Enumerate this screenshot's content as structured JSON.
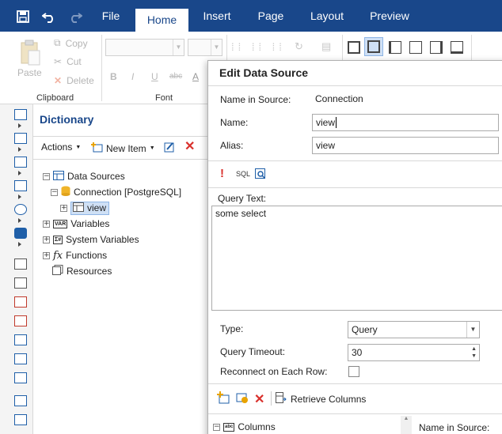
{
  "menubar": {
    "tabs": [
      {
        "label": "File"
      },
      {
        "label": "Home"
      },
      {
        "label": "Insert"
      },
      {
        "label": "Page"
      },
      {
        "label": "Layout"
      },
      {
        "label": "Preview"
      }
    ],
    "active_tab": "Home",
    "colors": {
      "bar": "#19478a",
      "active_text": "#19478a"
    }
  },
  "ribbon": {
    "clipboard": {
      "paste": "Paste",
      "copy": "Copy",
      "cut": "Cut",
      "delete": "Delete",
      "group_label": "Clipboard"
    },
    "font": {
      "group_label": "Font",
      "bold": "B",
      "italic": "I",
      "underline": "U",
      "strike": "abc",
      "color": "A"
    }
  },
  "dictionary": {
    "title": "Dictionary",
    "toolbar": {
      "actions": "Actions",
      "new_item": "New Item"
    },
    "tree": {
      "data_sources": "Data Sources",
      "connection": "Connection [PostgreSQL]",
      "view": "view",
      "variables": "Variables",
      "system_variables": "System Variables",
      "functions": "Functions",
      "resources": "Resources"
    }
  },
  "dialog": {
    "title": "Edit Data Source",
    "name_in_source_label": "Name in Source:",
    "name_in_source_value": "Connection",
    "name_label": "Name:",
    "name_value": "view",
    "alias_label": "Alias:",
    "alias_value": "view",
    "sql_label": "SQL",
    "query_text_label": "Query Text:",
    "query_text_value": "some select",
    "type_label": "Type:",
    "type_value": "Query",
    "timeout_label": "Query Timeout:",
    "timeout_value": "30",
    "reconnect_label": "Reconnect on Each Row:",
    "reconnect_checked": false,
    "retrieve_columns": "Retrieve Columns",
    "columns_node": "Columns",
    "name_in_source_col": "Name in Source:"
  }
}
